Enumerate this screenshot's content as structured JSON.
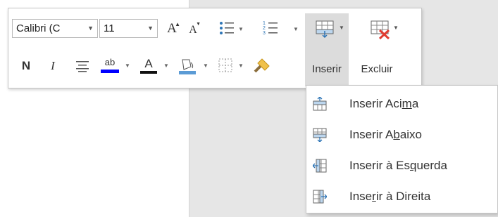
{
  "toolbar": {
    "font_name": "Calibri (C",
    "font_size": "11",
    "grow_font_icon": "A",
    "shrink_font_icon": "A",
    "bold_label": "N",
    "italic_label": "I",
    "highlight_label": "ab",
    "font_color_label": "A",
    "insert_label": "Inserir",
    "delete_label": "Excluir"
  },
  "menu": {
    "items": [
      {
        "pre": "Inserir Aci",
        "key": "m",
        "post": "a"
      },
      {
        "pre": "Inserir A",
        "key": "b",
        "post": "aixo"
      },
      {
        "pre": "Inserir à Es",
        "key": "q",
        "post": "uerda"
      },
      {
        "pre": "Inse",
        "key": "r",
        "post": "ir à Direita"
      }
    ]
  },
  "colors": {
    "highlight": "#0000ff",
    "font_color": "#c00000",
    "fill": "#5b9bd5",
    "delete_x": "#e03c31"
  }
}
